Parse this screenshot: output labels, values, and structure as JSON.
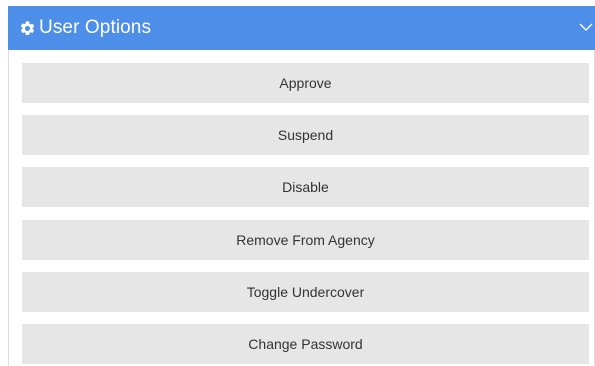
{
  "header": {
    "title": "User Options",
    "icon": "gear-icon",
    "toggle_icon": "chevron-down-icon",
    "background_color": "#4d8fe8",
    "text_color": "#ffffff"
  },
  "options": {
    "approve_label": "Approve",
    "suspend_label": "Suspend",
    "disable_label": "Disable",
    "remove_from_agency_label": "Remove From Agency",
    "toggle_undercover_label": "Toggle Undercover",
    "change_password_label": "Change Password",
    "button_color": "#e6e6e6"
  }
}
